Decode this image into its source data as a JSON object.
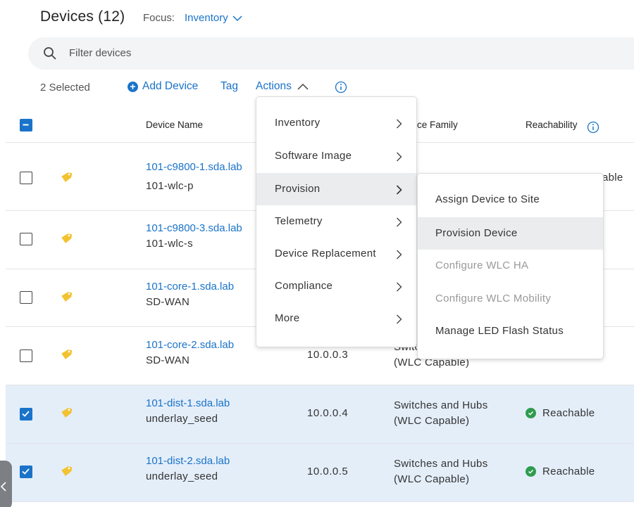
{
  "header": {
    "title": "Devices (12)",
    "focus_label": "Focus:",
    "focus_value": "Inventory"
  },
  "search": {
    "placeholder": "Filter devices"
  },
  "toolbar": {
    "selected": "2 Selected",
    "add_device": "Add Device",
    "tag": "Tag",
    "actions": "Actions"
  },
  "table": {
    "columns": {
      "device_name": "Device Name",
      "family": "ce Family",
      "reachability": "Reachability"
    },
    "rows": [
      {
        "name": "101-c9800-1.sda.lab",
        "sub": "101-wlc-p",
        "ip": "",
        "family1": "",
        "family2": "",
        "reach": "able",
        "checked": false
      },
      {
        "name": "101-c9800-3.sda.lab",
        "sub": "101-wlc-s",
        "ip": "",
        "family1": "",
        "family2": "",
        "reach": "",
        "checked": false
      },
      {
        "name": "101-core-1.sda.lab",
        "sub": "SD-WAN",
        "ip": "",
        "family1": "",
        "family2": "",
        "reach": "",
        "checked": false
      },
      {
        "name": "101-core-2.sda.lab",
        "sub": "SD-WAN",
        "ip": "10.0.0.3",
        "family1": "Switc",
        "family2": "(WLC Capable)",
        "reach": "",
        "checked": false
      },
      {
        "name": "101-dist-1.sda.lab",
        "sub": "underlay_seed",
        "ip": "10.0.0.4",
        "family1": "Switches and Hubs",
        "family2": "(WLC Capable)",
        "reach": "Reachable",
        "checked": true
      },
      {
        "name": "101-dist-2.sda.lab",
        "sub": "underlay_seed",
        "ip": "10.0.0.5",
        "family1": "Switches and Hubs",
        "family2": "(WLC Capable)",
        "reach": "Reachable",
        "checked": true
      }
    ]
  },
  "actions_menu": {
    "items": [
      {
        "label": "Inventory"
      },
      {
        "label": "Software Image"
      },
      {
        "label": "Provision",
        "active": true
      },
      {
        "label": "Telemetry"
      },
      {
        "label": "Device Replacement"
      },
      {
        "label": "Compliance"
      },
      {
        "label": "More"
      }
    ]
  },
  "provision_submenu": {
    "items": [
      {
        "label": "Assign Device to Site",
        "state": "enabled"
      },
      {
        "label": "Provision Device",
        "state": "hover"
      },
      {
        "label": "Configure WLC HA",
        "state": "disabled"
      },
      {
        "label": "Configure WLC Mobility",
        "state": "disabled"
      },
      {
        "label": "Manage LED Flash Status",
        "state": "enabled"
      }
    ]
  },
  "colors": {
    "link": "#1a73c9",
    "selected_row": "#e4eef9",
    "reachable": "#2e9c4f",
    "tag": "#f2c230"
  }
}
